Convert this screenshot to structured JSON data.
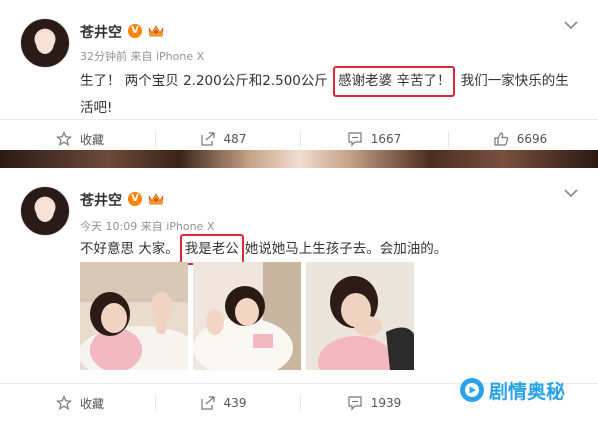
{
  "posts": [
    {
      "author": "苍井空",
      "time": "32分钟前",
      "source": "来自 iPhone X",
      "text_before": "生了！ 两个宝贝 2.200公斤和2.500公斤 ",
      "text_highlight": "感谢老婆 辛苦了！",
      "text_after": " 我们一家快乐的生活吧!",
      "actions": {
        "favorite": "收藏",
        "repost": "487",
        "comment": "1667",
        "like": "6696"
      }
    },
    {
      "author": "苍井空",
      "time": "今天 10:09",
      "source": "来自 iPhone X",
      "text_before": "不好意思 大家。",
      "text_highlight": "我是老公",
      "text_after": "她说她马上生孩子去。会加油的。",
      "actions": {
        "favorite": "收藏",
        "repost": "439",
        "comment": "1939"
      }
    }
  ],
  "watermark": "剧情奥秘",
  "colors": {
    "highlight": "#d8283a",
    "verified": "#ff8200",
    "watermark": "#2aa3e8"
  }
}
